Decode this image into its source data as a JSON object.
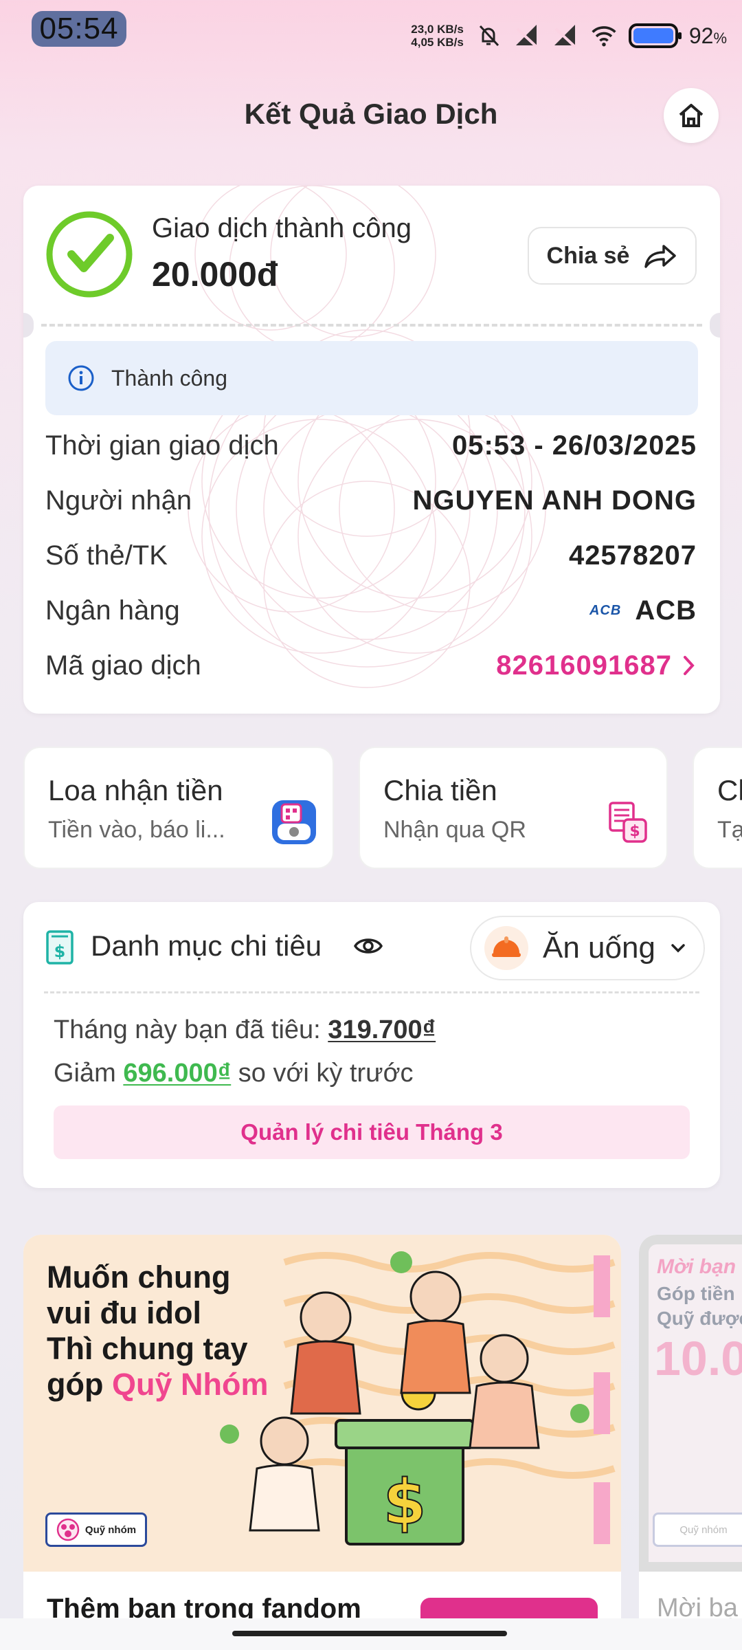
{
  "status_bar": {
    "time": "05:54",
    "speed_up": "23,0 KB/s",
    "speed_down": "4,05 KB/s",
    "battery_pct": "92",
    "battery_suffix": "%"
  },
  "header": {
    "title": "Kết Quả Giao Dịch"
  },
  "receipt": {
    "status_title": "Giao dịch thành công",
    "amount": "20.000đ",
    "share_label": "Chia sẻ",
    "info_text": "Thành công",
    "rows": [
      {
        "label": "Thời gian giao dịch",
        "value": "05:53 - 26/03/2025"
      },
      {
        "label": "Người nhận",
        "value": "NGUYEN ANH DONG"
      },
      {
        "label": "Số thẻ/TK",
        "value": "42578207"
      },
      {
        "label": "Ngân hàng",
        "value": "ACB",
        "logo": "ACB"
      },
      {
        "label": "Mã giao dịch",
        "value": "82616091687"
      }
    ]
  },
  "tiles": [
    {
      "title": "Loa nhận tiền",
      "subtitle": "Tiền vào, báo li...",
      "icon": "speaker-qr-icon"
    },
    {
      "title": "Chia tiền",
      "subtitle": "Nhận qua QR",
      "icon": "bill-split-icon"
    },
    {
      "title": "Cl",
      "subtitle": "Tạ",
      "icon": ""
    }
  ],
  "spending": {
    "title": "Danh mục chi tiêu",
    "category": "Ăn uống",
    "line1_prefix": "Tháng này bạn đã tiêu: ",
    "line1_amount": "319.700₫",
    "line2_prefix": "Giảm ",
    "line2_amount": "696.000₫",
    "line2_suffix": " so với kỳ trước",
    "manage_label": "Quản lý chi tiêu Tháng 3"
  },
  "promos": [
    {
      "line1": "Muốn chung",
      "line2": "vui đu idol",
      "line3": "Thì chung tay",
      "line4_prefix": "góp ",
      "line4_highlight": "Quỹ Nhóm",
      "badge": "Quỹ nhóm",
      "caption": "Thêm bạn trong fandom"
    },
    {
      "line1": "Mời bạn",
      "line2a": "Góp tiền",
      "line2b": "Quỹ được",
      "line3": "10.0",
      "badge": "Quỹ nhóm",
      "caption": "Mời bạ"
    }
  ],
  "colors": {
    "accent": "#e0308c",
    "success": "#6ecb2a",
    "positive": "#3fb94f"
  }
}
